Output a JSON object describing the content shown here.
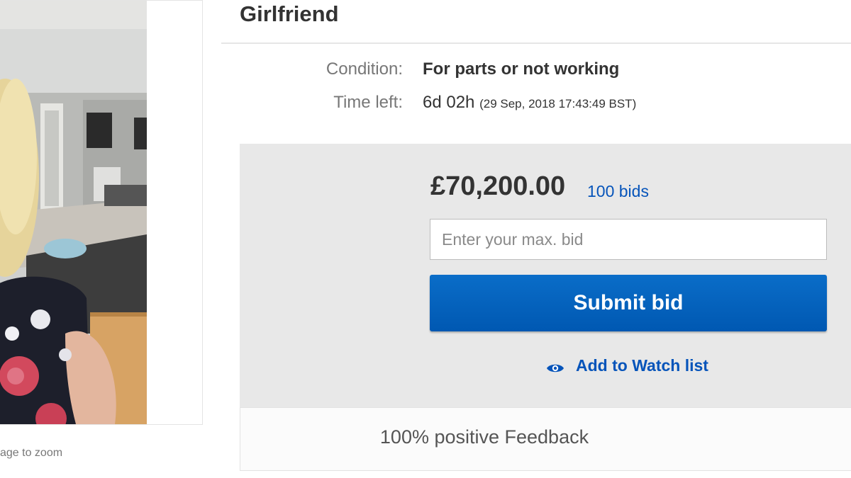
{
  "photo": {
    "zoom_hint": "age to zoom"
  },
  "item": {
    "title": "Girlfriend",
    "condition_label": "Condition:",
    "condition_value": "For parts or not working",
    "time_left_label": "Time left:",
    "time_left_value": "6d 02h",
    "end_time": "(29 Sep, 2018   17:43:49 BST)"
  },
  "bidding": {
    "price": "£70,200.00",
    "bids_link": "100 bids",
    "max_bid_placeholder": "Enter your max. bid",
    "submit_label": "Submit bid",
    "watch_label": "Add to Watch list"
  },
  "seller": {
    "feedback": "100% positive Feedback"
  },
  "colors": {
    "link_blue": "#0654ba",
    "button_blue": "#0a6dc8",
    "panel_gray": "#e8e8e8"
  }
}
